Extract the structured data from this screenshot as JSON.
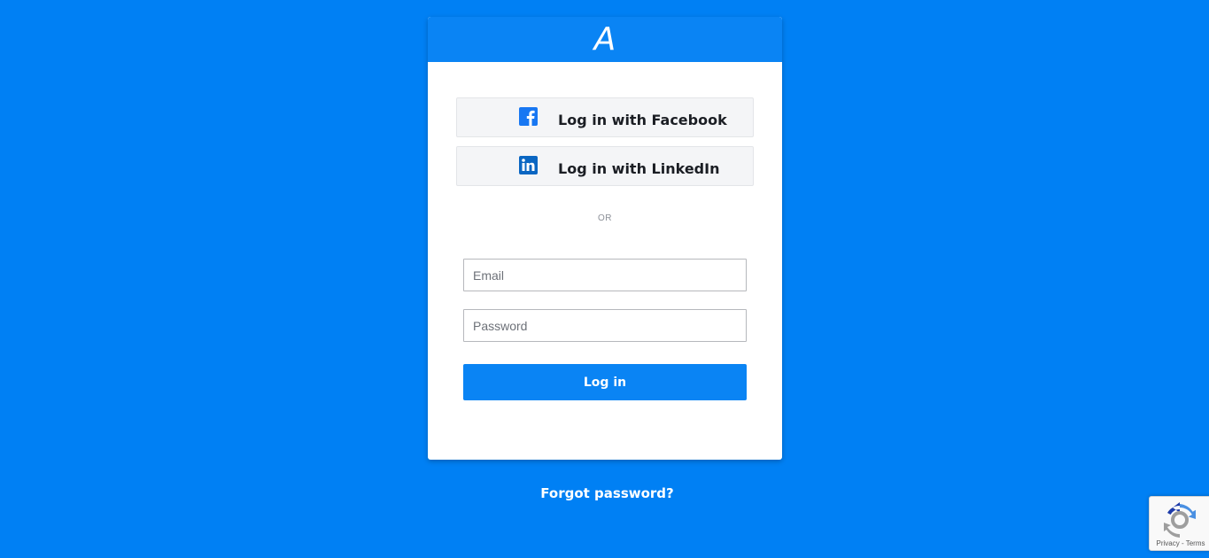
{
  "logo": {
    "text": "A"
  },
  "social": {
    "facebook_label": "Log in with Facebook",
    "linkedin_label": "Log in with LinkedIn"
  },
  "divider": {
    "text": "OR"
  },
  "form": {
    "email_placeholder": "Email",
    "email_value": "",
    "password_placeholder": "Password",
    "password_value": "",
    "submit_label": "Log in"
  },
  "forgot_password": "Forgot password?",
  "recaptcha": {
    "links": "Privacy - Terms"
  },
  "colors": {
    "background": "#0080f4",
    "accent": "#0a84f4",
    "facebook": "#1877f2",
    "linkedin": "#0a66c2"
  }
}
